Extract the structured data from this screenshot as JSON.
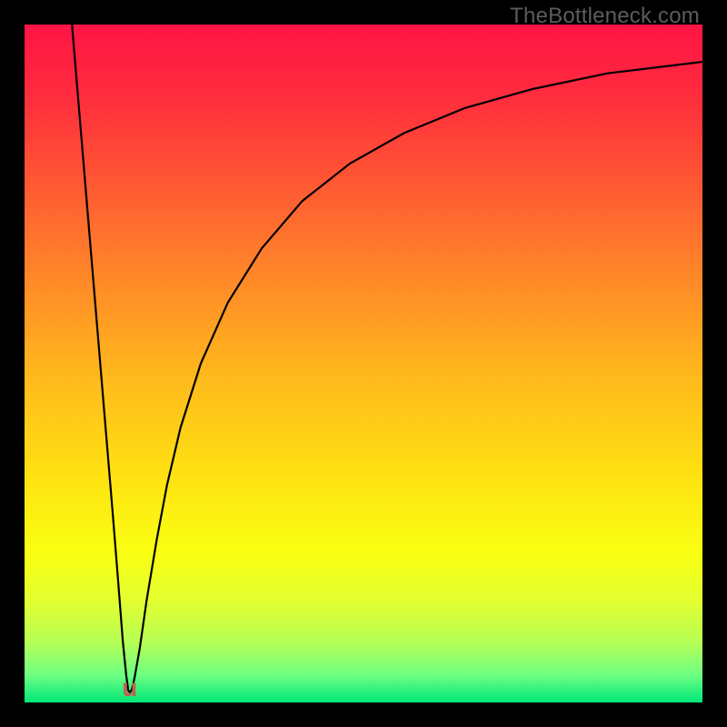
{
  "watermark": "TheBottleneck.com",
  "u_marker_glyph": "u",
  "chart_data": {
    "type": "line",
    "title": "",
    "xlabel": "",
    "ylabel": "",
    "xlim": [
      0,
      100
    ],
    "ylim": [
      0,
      100
    ],
    "grid": false,
    "legend": false,
    "annotations": [],
    "background_gradient": {
      "stops": [
        {
          "pos": 0.0,
          "color": "#ff1444"
        },
        {
          "pos": 0.1,
          "color": "#ff2b3e"
        },
        {
          "pos": 0.22,
          "color": "#ff5334"
        },
        {
          "pos": 0.38,
          "color": "#ff8a28"
        },
        {
          "pos": 0.52,
          "color": "#ffb91c"
        },
        {
          "pos": 0.67,
          "color": "#ffe312"
        },
        {
          "pos": 0.78,
          "color": "#f9ff12"
        },
        {
          "pos": 0.85,
          "color": "#e3ff30"
        },
        {
          "pos": 0.91,
          "color": "#b7ff54"
        },
        {
          "pos": 0.96,
          "color": "#6cff82"
        },
        {
          "pos": 1.0,
          "color": "#00e777"
        }
      ]
    },
    "optimum_x": 15.5,
    "curve": {
      "description": "Bottleneck percentage (y, 0 at bottom) vs component strength (x). Two branches meeting at a narrow minimum near x≈15.5.",
      "points_xy": [
        [
          7.0,
          100.0
        ],
        [
          8.0,
          88.0
        ],
        [
          9.0,
          76.0
        ],
        [
          10.0,
          64.0
        ],
        [
          11.0,
          52.0
        ],
        [
          12.0,
          40.0
        ],
        [
          13.0,
          28.0
        ],
        [
          13.8,
          18.0
        ],
        [
          14.5,
          9.0
        ],
        [
          15.0,
          4.0
        ],
        [
          15.3,
          1.8
        ],
        [
          15.5,
          1.5
        ],
        [
          15.8,
          1.8
        ],
        [
          16.2,
          3.5
        ],
        [
          17.0,
          8.0
        ],
        [
          18.0,
          15.0
        ],
        [
          19.5,
          24.0
        ],
        [
          21.0,
          32.0
        ],
        [
          23.0,
          40.5
        ],
        [
          26.0,
          50.0
        ],
        [
          30.0,
          59.0
        ],
        [
          35.0,
          67.0
        ],
        [
          41.0,
          74.0
        ],
        [
          48.0,
          79.5
        ],
        [
          56.0,
          84.0
        ],
        [
          65.0,
          87.7
        ],
        [
          75.0,
          90.5
        ],
        [
          86.0,
          92.8
        ],
        [
          100.0,
          94.5
        ]
      ]
    },
    "u_marker": {
      "x": 15.5,
      "y": 2.2,
      "font_px": 28
    }
  }
}
